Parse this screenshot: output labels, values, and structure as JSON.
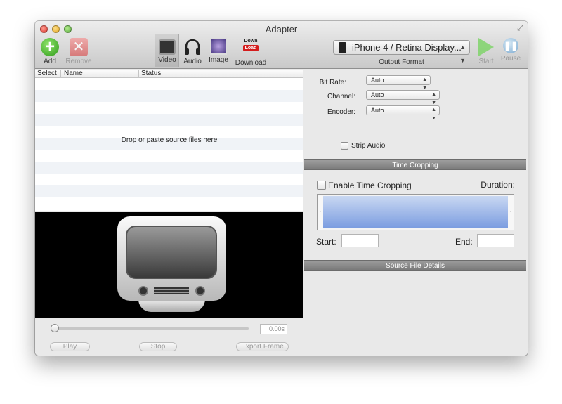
{
  "window": {
    "title": "Adapter"
  },
  "toolbar": {
    "add_label": "Add",
    "remove_label": "Remove",
    "video_label": "Video",
    "audio_label": "Audio",
    "image_label": "Image",
    "download_label": "Download",
    "download_icon_top": "Down",
    "download_icon_bottom": "Load",
    "start_label": "Start",
    "pause_label": "Pause"
  },
  "output_format": {
    "selected": "iPhone 4 / Retina Display...",
    "label": "Output Format"
  },
  "file_list": {
    "columns": [
      "Select",
      "Name",
      "Status"
    ],
    "empty_text": "Drop or paste source files here"
  },
  "player": {
    "time": "0.00s",
    "play_label": "Play",
    "stop_label": "Stop",
    "export_label": "Export Frame",
    "position": 0
  },
  "settings": {
    "bit_rate_label": "Bit Rate:",
    "bit_rate_value": "Auto",
    "channel_label": "Channel:",
    "channel_value": "Auto",
    "encoder_label": "Encoder:",
    "encoder_value": "Auto",
    "strip_audio_label": "Strip Audio",
    "strip_audio_checked": false
  },
  "time_cropping": {
    "section_title": "Time Cropping",
    "enable_label": "Enable Time Cropping",
    "enabled": false,
    "duration_label": "Duration:",
    "start_label": "Start:",
    "end_label": "End:",
    "start_value": "",
    "end_value": ""
  },
  "source_details": {
    "section_title": "Source File Details"
  },
  "icons": {
    "add": "plus-circle-icon",
    "remove": "x-square-icon",
    "video": "monitor-icon",
    "audio": "headphones-icon",
    "image": "photo-icon",
    "download": "download-badge-icon",
    "start": "play-triangle-icon",
    "pause": "pause-circle-icon"
  },
  "colors": {
    "add_green": "#2e9a1a",
    "remove_red": "#d75c5c",
    "start_green": "#7fd46a",
    "pause_blue": "#7aa9cf",
    "section_gray": "#8a8a8a",
    "crop_blue": "#7a9ce0"
  }
}
